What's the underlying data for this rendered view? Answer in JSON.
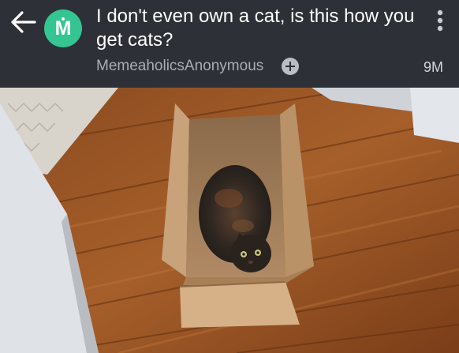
{
  "post": {
    "title": "I don't even own a cat, is this how you get cats?",
    "community": "MemeaholicsAnonymous",
    "age": "9M",
    "avatar_letter": "M"
  },
  "icons": {
    "back": "back-arrow-icon",
    "menu": "more-vertical-icon",
    "join": "plus-circle-icon"
  },
  "colors": {
    "header_bg": "#2d3036",
    "avatar_bg": "#35c592",
    "title_text": "#ffffff",
    "meta_text": "#a9adb5"
  }
}
